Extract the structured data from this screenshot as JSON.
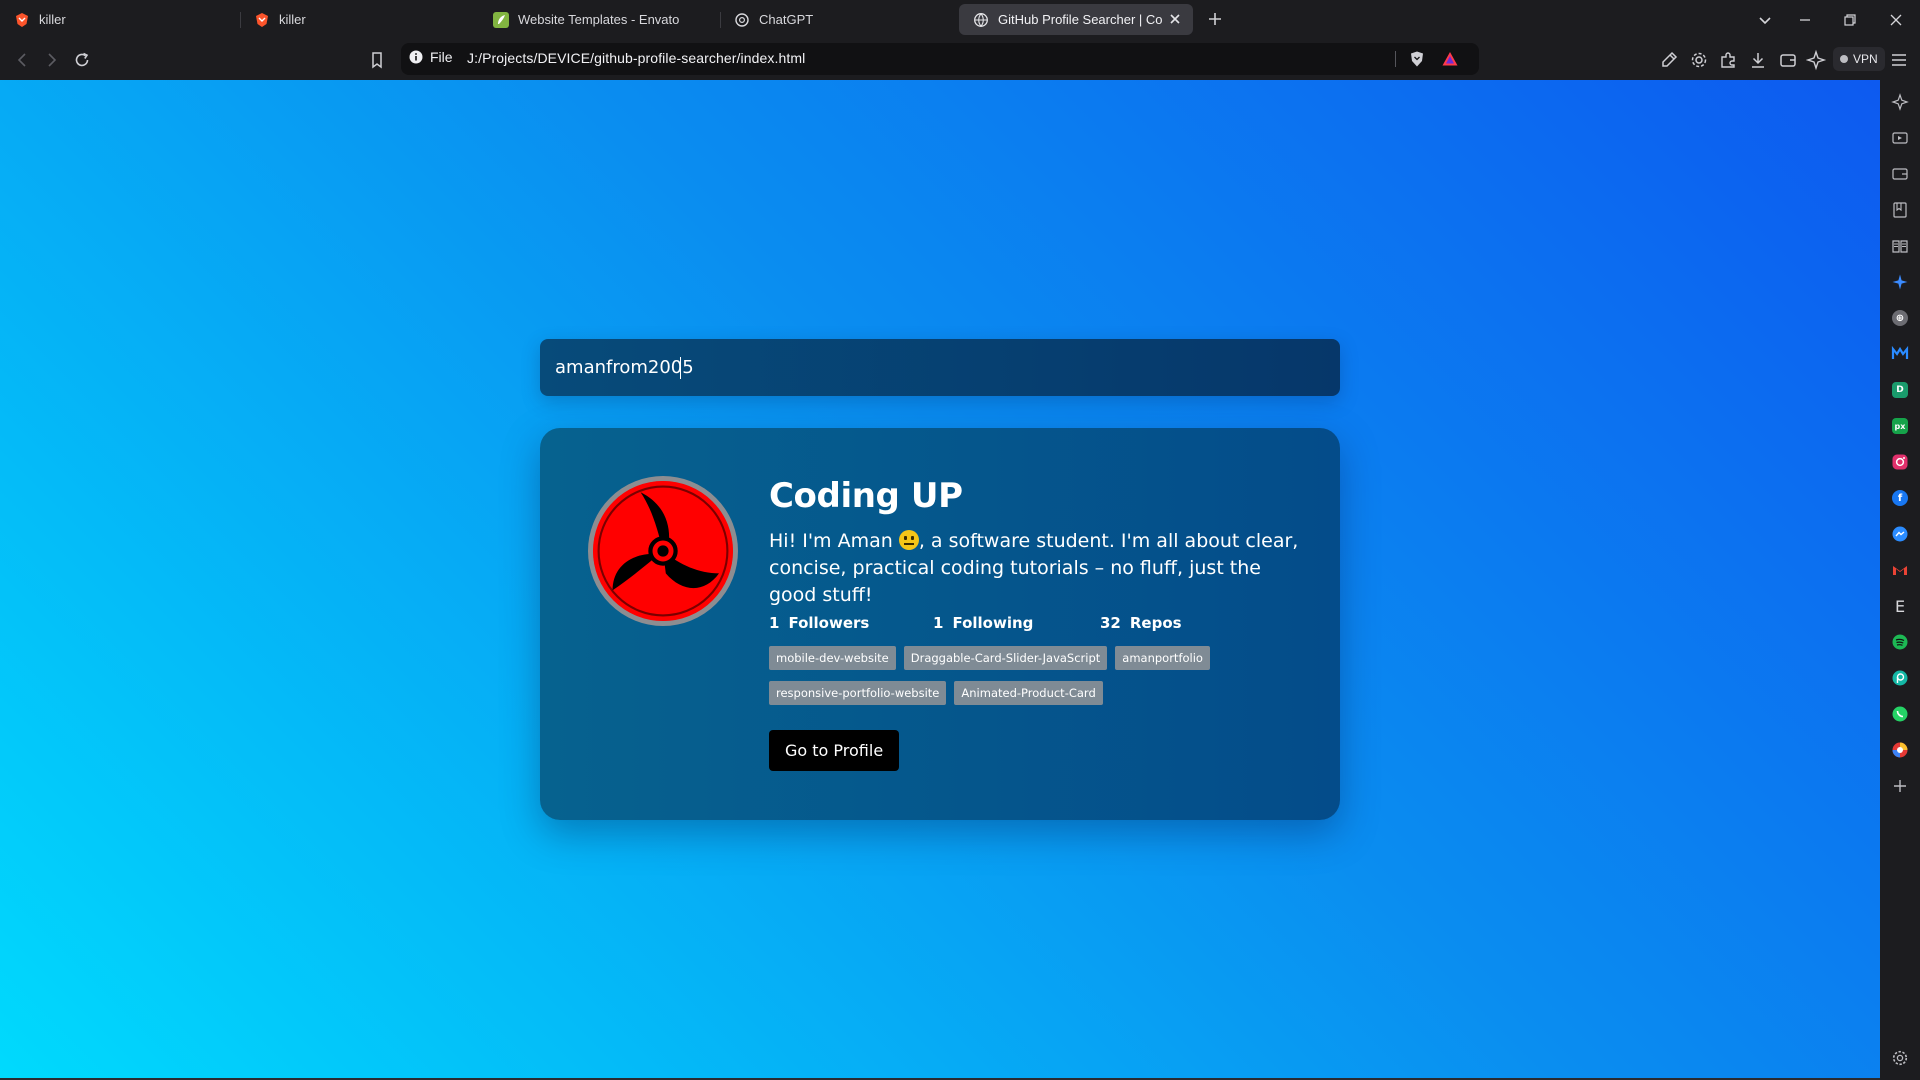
{
  "tabs": [
    {
      "title": "killer",
      "favicon": "brave-lion-icon",
      "active": false
    },
    {
      "title": "killer",
      "favicon": "brave-lion-icon",
      "active": false
    },
    {
      "title": "Website Templates - Envato",
      "favicon": "envato-icon",
      "active": false
    },
    {
      "title": "ChatGPT",
      "favicon": "chatgpt-icon",
      "active": false
    },
    {
      "title": "GitHub Profile Searcher | Codin",
      "favicon": "globe-icon",
      "active": true
    }
  ],
  "toolbar": {
    "site_label": "File",
    "url": "J:/Projects/DEVICE/github-profile-searcher/index.html",
    "vpn_label": "VPN"
  },
  "search": {
    "value": "amanfrom2005"
  },
  "profile": {
    "name": "Coding UP",
    "bio_before": "Hi! I'm Aman ",
    "bio_after": ", a software student. I'm all about clear, concise, practical coding tutorials – no fluff, just the good stuff!",
    "stats": [
      {
        "value": "1",
        "label": "Followers"
      },
      {
        "value": "1",
        "label": "Following"
      },
      {
        "value": "32",
        "label": "Repos"
      }
    ],
    "repos": [
      "mobile-dev-website",
      "Draggable-Card-Slider-JavaScript",
      "amanportfolio",
      "responsive-portfolio-website",
      "Animated-Product-Card"
    ],
    "button_label": "Go to Profile"
  },
  "sidebar_icons": [
    "leo-ai-icon",
    "playlist-icon",
    "wallet-icon",
    "bookmarks-icon",
    "reading-list-icon",
    "sparkle-icon",
    "globe-extension-icon",
    "malwarebytes-icon",
    "deepl-icon",
    "px-icon",
    "instagram-icon",
    "facebook-icon",
    "messenger-icon",
    "gmail-icon",
    "envato-e-icon",
    "spotify-icon",
    "pixiv-icon",
    "whatsapp-icon",
    "chrome-like-icon",
    "add-icon",
    "settings-icon"
  ],
  "colors": {
    "page_gradient_start": "#00dafd",
    "page_gradient_end": "#0d5af0",
    "card_bg": "#06628f",
    "repo_chip": "#7f8b95",
    "button_bg": "#000000",
    "avatar_red": "#ff0000"
  }
}
